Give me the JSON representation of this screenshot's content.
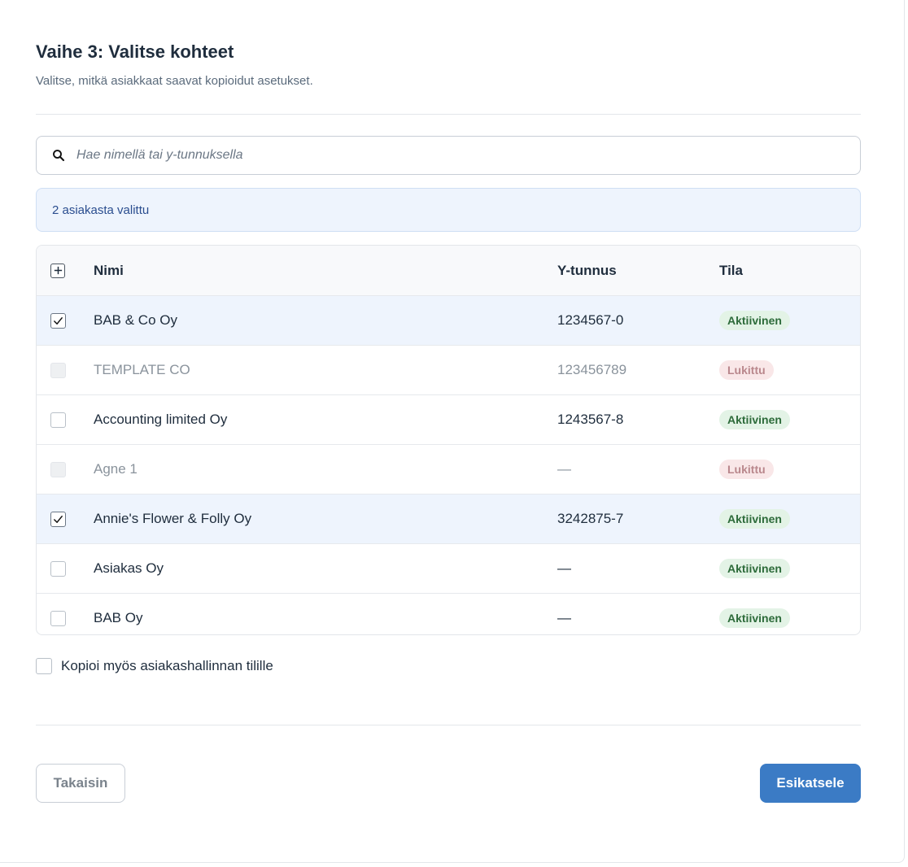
{
  "step": {
    "title": "Vaihe 3: Valitse kohteet",
    "subtitle": "Valitse, mitkä asiakkaat saavat kopioidut asetukset."
  },
  "search": {
    "placeholder": "Hae nimellä tai y-tunnuksella",
    "value": ""
  },
  "selection": {
    "summary": "2 asiakasta valittu"
  },
  "table": {
    "columns": {
      "name": "Nimi",
      "ytunnus": "Y-tunnus",
      "status": "Tila"
    },
    "rows": [
      {
        "name": "BAB & Co Oy",
        "ytunnus": "1234567-0",
        "status": "Aktiivinen",
        "checked": true,
        "locked": false
      },
      {
        "name": "TEMPLATE CO",
        "ytunnus": "123456789",
        "status": "Lukittu",
        "checked": false,
        "locked": true
      },
      {
        "name": "Accounting limited Oy",
        "ytunnus": "1243567-8",
        "status": "Aktiivinen",
        "checked": false,
        "locked": false
      },
      {
        "name": "Agne 1",
        "ytunnus": "—",
        "status": "Lukittu",
        "checked": false,
        "locked": true
      },
      {
        "name": "Annie's Flower & Folly Oy",
        "ytunnus": "3242875-7",
        "status": "Aktiivinen",
        "checked": true,
        "locked": false
      },
      {
        "name": "Asiakas Oy",
        "ytunnus": "—",
        "status": "Aktiivinen",
        "checked": false,
        "locked": false
      },
      {
        "name": "BAB Oy",
        "ytunnus": "—",
        "status": "Aktiivinen",
        "checked": false,
        "locked": false
      }
    ]
  },
  "copy_option": {
    "label": "Kopioi myös asiakashallinnan tilille",
    "checked": false
  },
  "buttons": {
    "back": "Takaisin",
    "preview": "Esikatsele"
  },
  "icons": {
    "search": "search-icon",
    "select_all": "plus-icon",
    "check": "checkmark-icon"
  },
  "colors": {
    "primary": "#3b7bc5",
    "active_badge_bg": "#e3f3e6",
    "active_badge_text": "#2d6b3a",
    "locked_badge_bg": "#f9e7e8",
    "locked_badge_text": "#b9878c",
    "selected_row_bg": "#eef4fd"
  }
}
